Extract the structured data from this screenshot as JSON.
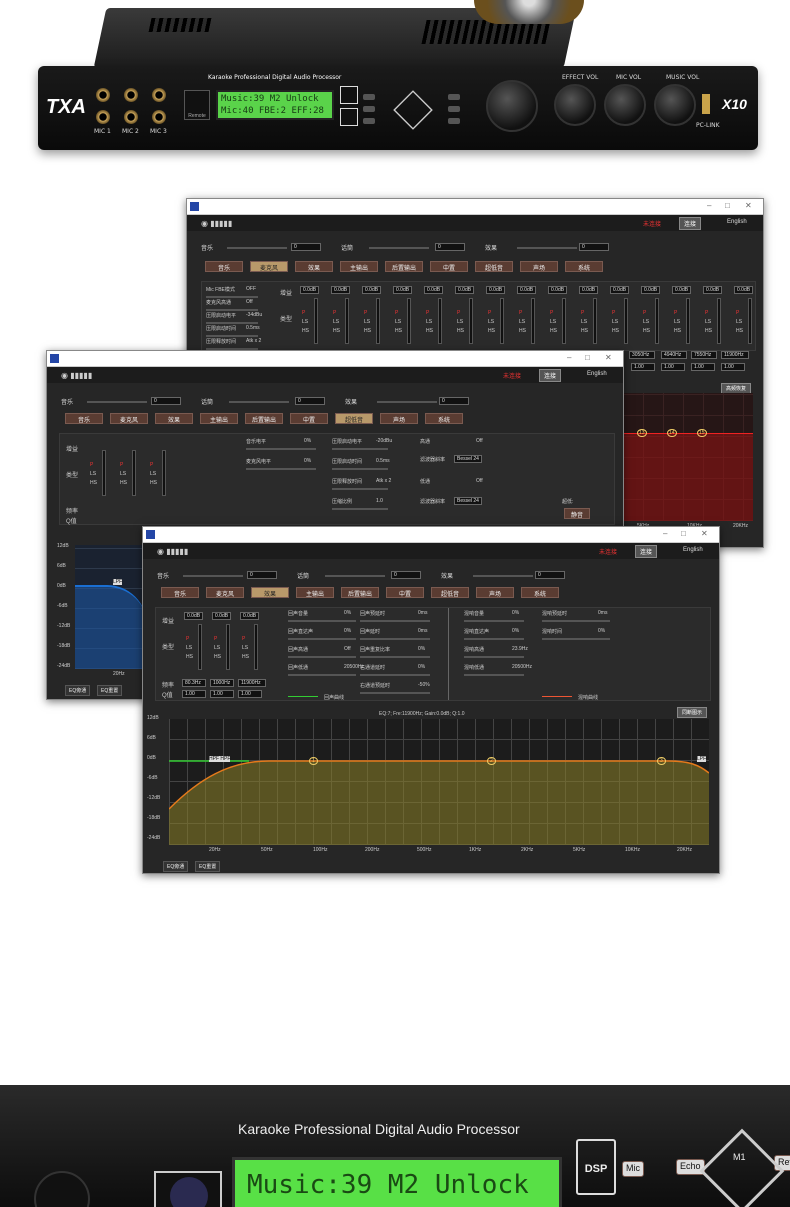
{
  "device": {
    "brand": "TXA",
    "model": "X10",
    "subtitle": "Karaoke Professional Digital Audio Processor",
    "mic_labels": [
      "MIC 1",
      "MIC 2",
      "MIC 3"
    ],
    "remote": "Remote",
    "lcd_line1": "Music:39  M2  Unlock",
    "lcd_line2": "Mic:40 FBE:2  EFF:28",
    "knob_labels": [
      "EFFECT VOL",
      "MIC VOL",
      "MUSIC VOL"
    ],
    "pclink": "PC-LINK"
  },
  "app": {
    "status": "未连接",
    "connect": "连接",
    "language": "English",
    "vol_labels": [
      "音乐",
      "话筒",
      "效果"
    ],
    "vol_values": [
      "0",
      "0",
      "0"
    ],
    "tabs": [
      "音乐",
      "麦克风",
      "效果",
      "主输出",
      "后置输出",
      "中置",
      "超低音",
      "声场",
      "系统"
    ]
  },
  "win1": {
    "active_tab": 1,
    "mic_settings": [
      "Mic FBE模式",
      "麦克风高通",
      "压限启动电平",
      "压限启动时间",
      "压限释放时间"
    ],
    "mic_values": [
      "OFF",
      "Off",
      "-34dBu",
      "0.5ms",
      "Atk x 2"
    ],
    "gain_label": "增益",
    "type_label": "类型",
    "band_gains": [
      "0.0dB",
      "0.0dB",
      "0.0dB",
      "0.0dB",
      "0.0dB",
      "0.0dB",
      "0.0dB",
      "0.0dB",
      "0.0dB",
      "0.0dB",
      "0.0dB",
      "0.0dB",
      "0.0dB",
      "0.0dB",
      "0.0dB"
    ],
    "freqs": [
      "3050Hz",
      "4940Hz",
      "7550Hz",
      "11900Hz"
    ],
    "q_values": [
      "1.00",
      "1.00",
      "1.00",
      "1.00"
    ],
    "reset": "高频恢复",
    "markers": [
      "13",
      "14",
      "15"
    ],
    "x_ticks": [
      "5KHz",
      "10KHz",
      "20KHz"
    ]
  },
  "win2": {
    "active_tab": 6,
    "gain_label": "增益",
    "type_label": "类型",
    "freq_label": "频率",
    "q_label": "Q值",
    "levels": [
      "音乐电平",
      "麦克风电平"
    ],
    "level_values": [
      "0%",
      "0%"
    ],
    "comp": [
      "压限启动电平",
      "压限启动时间",
      "压限释放时间",
      "压缩比例"
    ],
    "comp_values": [
      "-20dBu",
      "0.5ms",
      "Atk x 2",
      "1.0"
    ],
    "hp": "高通",
    "hp_value": "Off",
    "slope": "滤波器斜率",
    "slope_value": "Bessel 24",
    "lp": "低通",
    "lp_value": "Off",
    "sub_label": "超低:",
    "mute": "静音",
    "y_ticks": [
      "12dB",
      "6dB",
      "0dB",
      "-6dB",
      "-12dB",
      "-18dB",
      "-24dB"
    ],
    "x_tick": "20Hz",
    "lpf": "LPF",
    "bypass": "EQ旁通",
    "eqreset": "EQ重置"
  },
  "win3": {
    "active_tab": 2,
    "gain_label": "增益",
    "type_label": "类型",
    "freq_label": "频率",
    "q_label": "Q值",
    "band_gains": [
      "0.0dB",
      "0.0dB",
      "0.0dB"
    ],
    "freqs": [
      "80.3Hz",
      "1000Hz",
      "11900Hz"
    ],
    "q_values": [
      "1.00",
      "1.00",
      "1.00"
    ],
    "echo_left": [
      "回声音量",
      "回声直达声",
      "回声高通",
      "回声低通"
    ],
    "echo_left_values": [
      "0%",
      "0%",
      "Off",
      "20500Hz"
    ],
    "echo_mid": [
      "回声预延时",
      "回声延时",
      "回声重复比率",
      "右通道延时",
      "右通道预延时"
    ],
    "echo_mid_values": [
      "0ms",
      "0ms",
      "0%",
      "0%",
      "-50%"
    ],
    "echo_curve": "回声曲线",
    "reverb_left": [
      "混响音量",
      "混响直达声",
      "混响高通",
      "混响低通"
    ],
    "reverb_left_values": [
      "0%",
      "0%",
      "23.9Hz",
      "20500Hz"
    ],
    "reverb_mid": [
      "混响预延时",
      "混响时间"
    ],
    "reverb_mid_values": [
      "0ms",
      "0%"
    ],
    "reverb_curve": "混响曲线",
    "eq_info": "EQ:7; Fre:11900Hz; Gain:0.0dB; Q:1.0",
    "reset": "同断图示",
    "y_ticks": [
      "12dB",
      "6dB",
      "0dB",
      "-6dB",
      "-12dB",
      "-18dB",
      "-24dB"
    ],
    "x_ticks": [
      "20Hz",
      "50Hz",
      "100Hz",
      "200Hz",
      "500Hz",
      "1KHz",
      "2KHz",
      "5KHz",
      "10KHz",
      "20KHz"
    ],
    "hpf": "HPF HPF",
    "lpf": "LPF",
    "points": [
      "1",
      "2",
      "3"
    ],
    "bypass": "EQ旁通",
    "eqreset": "EQ重置"
  },
  "closeup": {
    "title": "Karaoke Professional Digital Audio Processor",
    "lcd": "Music:39  M2  Unlock",
    "dsp": "DSP",
    "buttons": [
      "Mic",
      "Echo",
      "M1",
      "Rev"
    ]
  }
}
